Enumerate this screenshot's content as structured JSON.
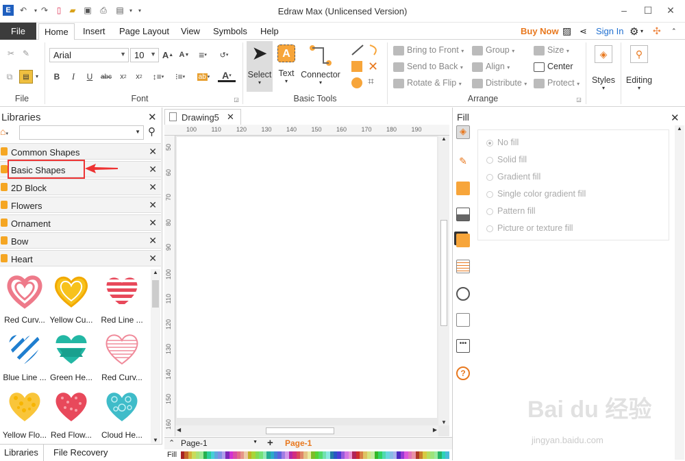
{
  "app": {
    "title": "Edraw Max (Unlicensed Version)"
  },
  "menu": {
    "file": "File",
    "tabs": [
      "Home",
      "Insert",
      "Page Layout",
      "View",
      "Symbols",
      "Help"
    ],
    "buy_now": "Buy Now",
    "sign_in": "Sign In"
  },
  "ribbon": {
    "font_name": "Arial",
    "font_size": "10",
    "groups": {
      "file": "File",
      "font": "Font",
      "basic_tools": "Basic Tools",
      "arrange": "Arrange"
    },
    "tools": {
      "select": "Select",
      "text": "Text",
      "connector": "Connector"
    },
    "arrange": {
      "bring_to_front": "Bring to Front",
      "send_to_back": "Send to Back",
      "rotate_flip": "Rotate & Flip",
      "group": "Group",
      "align": "Align",
      "distribute": "Distribute",
      "size": "Size",
      "center": "Center",
      "protect": "Protect"
    },
    "styles": "Styles",
    "editing": "Editing"
  },
  "libraries": {
    "title": "Libraries",
    "items": [
      "Common Shapes",
      "Basic Shapes",
      "2D Block",
      "Flowers",
      "Ornament",
      "Bow",
      "Heart"
    ],
    "shapes": [
      {
        "label": "Red Curv...",
        "color": "#ee7a8a"
      },
      {
        "label": "Yellow Cu...",
        "color": "#f7c21c"
      },
      {
        "label": "Red Line ...",
        "color": "#e8495b"
      },
      {
        "label": "Blue Line ...",
        "color": "#1f7ecf"
      },
      {
        "label": "Green He...",
        "color": "#23b7a4"
      },
      {
        "label": "Red Curv...",
        "color": "#f08a9a"
      },
      {
        "label": "Yellow Flo...",
        "color": "#f9c53a"
      },
      {
        "label": "Red Flow...",
        "color": "#e8495b"
      },
      {
        "label": "Cloud He...",
        "color": "#3fbcc9"
      }
    ]
  },
  "bottom_tabs": {
    "libraries": "Libraries",
    "file_recovery": "File Recovery"
  },
  "document": {
    "tab": "Drawing5",
    "ruler_top": [
      "100",
      "110",
      "120",
      "130",
      "140",
      "150",
      "160",
      "170",
      "180",
      "190"
    ],
    "ruler_left": [
      "50",
      "60",
      "70",
      "80",
      "90",
      "100",
      "110",
      "120",
      "130",
      "140",
      "150",
      "160"
    ],
    "page_select": "Page-1",
    "page_tab": "Page-1",
    "fill_label": "Fill"
  },
  "fill_panel": {
    "title": "Fill",
    "options": [
      "No fill",
      "Solid fill",
      "Gradient fill",
      "Single color gradient fill",
      "Pattern fill",
      "Picture or texture fill"
    ]
  },
  "watermark": {
    "main": "Bai du 经验",
    "sub": "jingyan.baidu.com"
  }
}
